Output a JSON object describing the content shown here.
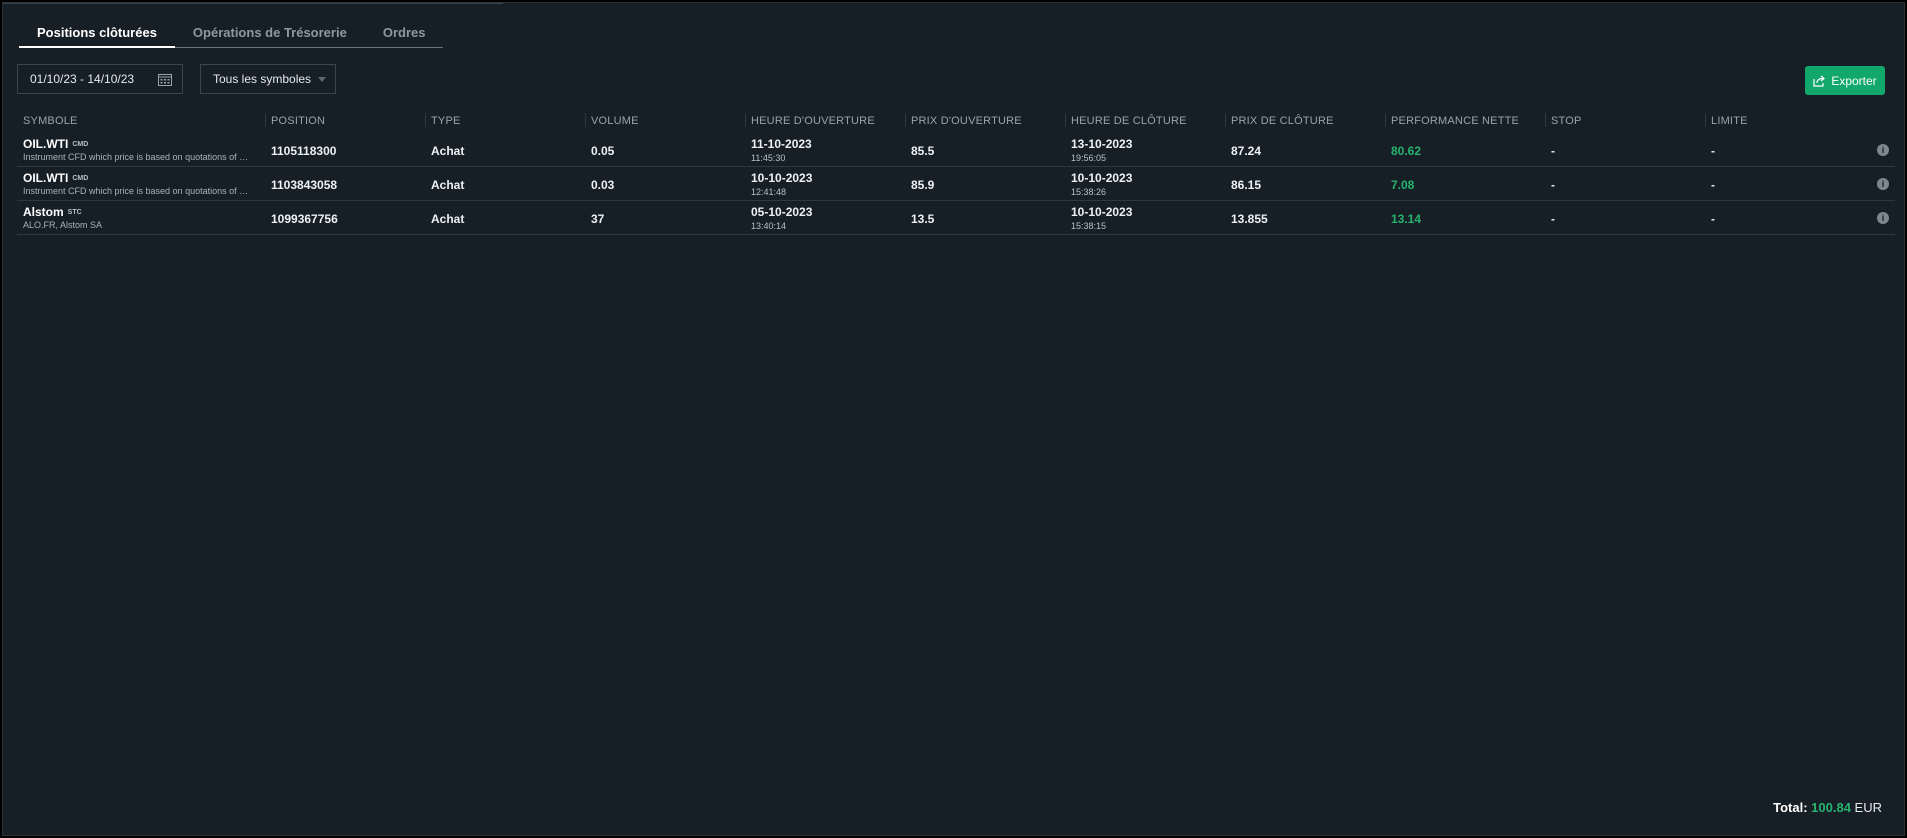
{
  "tabs": [
    {
      "label": "Positions clôturées",
      "active": true
    },
    {
      "label": "Opérations de Trésorerie",
      "active": false
    },
    {
      "label": "Ordres",
      "active": false
    }
  ],
  "filters": {
    "date_range": "01/10/23 - 14/10/23",
    "symbol_select": "Tous les symboles",
    "calendar_icon": "calendar-icon"
  },
  "export": {
    "label": "Exporter",
    "icon": "share-icon"
  },
  "columns": [
    "SYMBOLE",
    "POSITION",
    "TYPE",
    "VOLUME",
    "HEURE D'OUVERTURE",
    "PRIX D'OUVERTURE",
    "HEURE DE CLÔTURE",
    "PRIX DE CLÔTURE",
    "PERFORMANCE NETTE",
    "STOP",
    "LIMITE"
  ],
  "rows": [
    {
      "symbol": "OIL.WTI",
      "badge": "CMD",
      "desc": "Instrument CFD which price is based on quotations of …",
      "position": "1105118300",
      "type": "Achat",
      "volume": "0.05",
      "open_date": "11-10-2023",
      "open_time": "11:45:30",
      "open_price": "85.5",
      "close_date": "13-10-2023",
      "close_time": "19:56:05",
      "close_price": "87.24",
      "performance": "80.62",
      "stop": "-",
      "limit": "-"
    },
    {
      "symbol": "OIL.WTI",
      "badge": "CMD",
      "desc": "Instrument CFD which price is based on quotations of …",
      "position": "1103843058",
      "type": "Achat",
      "volume": "0.03",
      "open_date": "10-10-2023",
      "open_time": "12:41:48",
      "open_price": "85.9",
      "close_date": "10-10-2023",
      "close_time": "15:38:26",
      "close_price": "86.15",
      "performance": "7.08",
      "stop": "-",
      "limit": "-"
    },
    {
      "symbol": "Alstom",
      "badge": "STC",
      "desc": "ALO.FR, Alstom SA",
      "position": "1099367756",
      "type": "Achat",
      "volume": "37",
      "open_date": "05-10-2023",
      "open_time": "13:40:14",
      "open_price": "13.5",
      "close_date": "10-10-2023",
      "close_time": "15:38:15",
      "close_price": "13.855",
      "performance": "13.14",
      "stop": "-",
      "limit": "-"
    }
  ],
  "total": {
    "label": "Total:",
    "value": "100.84",
    "currency": "EUR"
  },
  "colors": {
    "accent": "#13a86b",
    "positive": "#27b36f",
    "background": "#161f26"
  }
}
